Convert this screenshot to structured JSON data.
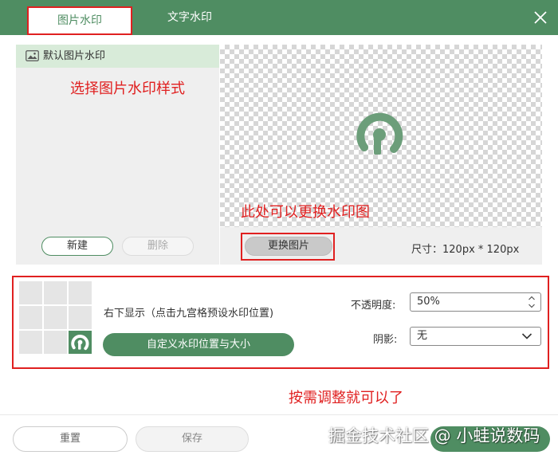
{
  "tabs": [
    {
      "label": "图片水印"
    },
    {
      "label": "文字水印"
    }
  ],
  "left_panel": {
    "item_label": "默认图片水印",
    "new_button": "新建",
    "delete_button": "删除"
  },
  "preview": {
    "replace_button": "更换图片",
    "size_label": "尺寸：120px * 120px"
  },
  "position": {
    "label": "右下显示（点击九宫格预设水印位置)",
    "custom_button": "自定义水印位置与大小",
    "selected_cell": 8
  },
  "opacity": {
    "label": "不透明度:",
    "value": "50%"
  },
  "shadow": {
    "label": "阴影:",
    "value": "无"
  },
  "footer": {
    "reset_button": "重置",
    "save_button": "保存"
  },
  "annotations": {
    "choose_style": "选择图片水印样式",
    "replace_here": "此处可以更换水印图",
    "adjust": "按需调整就可以了"
  },
  "site_watermark": "掘金技术社区 @ 小蛙说数码",
  "colors": {
    "brand_green": "#4f8d62",
    "annotation_red": "#e02020"
  }
}
